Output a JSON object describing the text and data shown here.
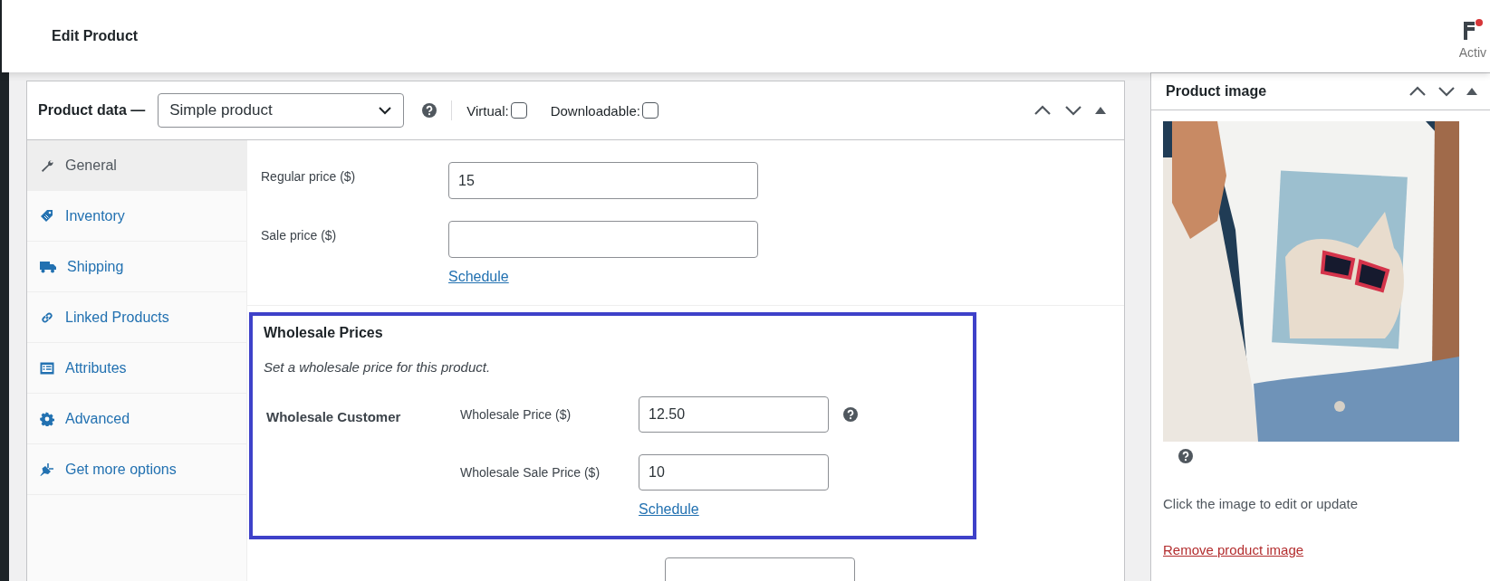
{
  "header": {
    "title": "Edit Product",
    "activity_label": "Activ"
  },
  "product_data": {
    "title": "Product data —",
    "product_type": "Simple product",
    "virtual": {
      "label": "Virtual:",
      "checked": false
    },
    "downloadable": {
      "label": "Downloadable:",
      "checked": false
    }
  },
  "tabs": [
    {
      "label": "General",
      "selected": true
    },
    {
      "label": "Inventory",
      "selected": false
    },
    {
      "label": "Shipping",
      "selected": false
    },
    {
      "label": "Linked Products",
      "selected": false
    },
    {
      "label": "Attributes",
      "selected": false
    },
    {
      "label": "Advanced",
      "selected": false
    },
    {
      "label": "Get more options",
      "selected": false
    }
  ],
  "general_fields": [
    {
      "label": "Regular price ($)",
      "value": "15"
    },
    {
      "label": "Sale price ($)"
    }
  ],
  "schedule_link": "Schedule",
  "wholesale": {
    "title": "Wholesale Prices",
    "description": "Set a wholesale price for this product.",
    "role": "Wholesale Customer",
    "fields": [
      {
        "label": "Wholesale Price ($)",
        "value": "12.50",
        "help": true
      },
      {
        "label": "Wholesale Sale Price ($)",
        "value": "10",
        "help": false
      }
    ],
    "schedule_link": "Schedule"
  },
  "product_image": {
    "title": "Product image",
    "hint": "Click the image to edit or update",
    "remove_link": "Remove product image"
  }
}
